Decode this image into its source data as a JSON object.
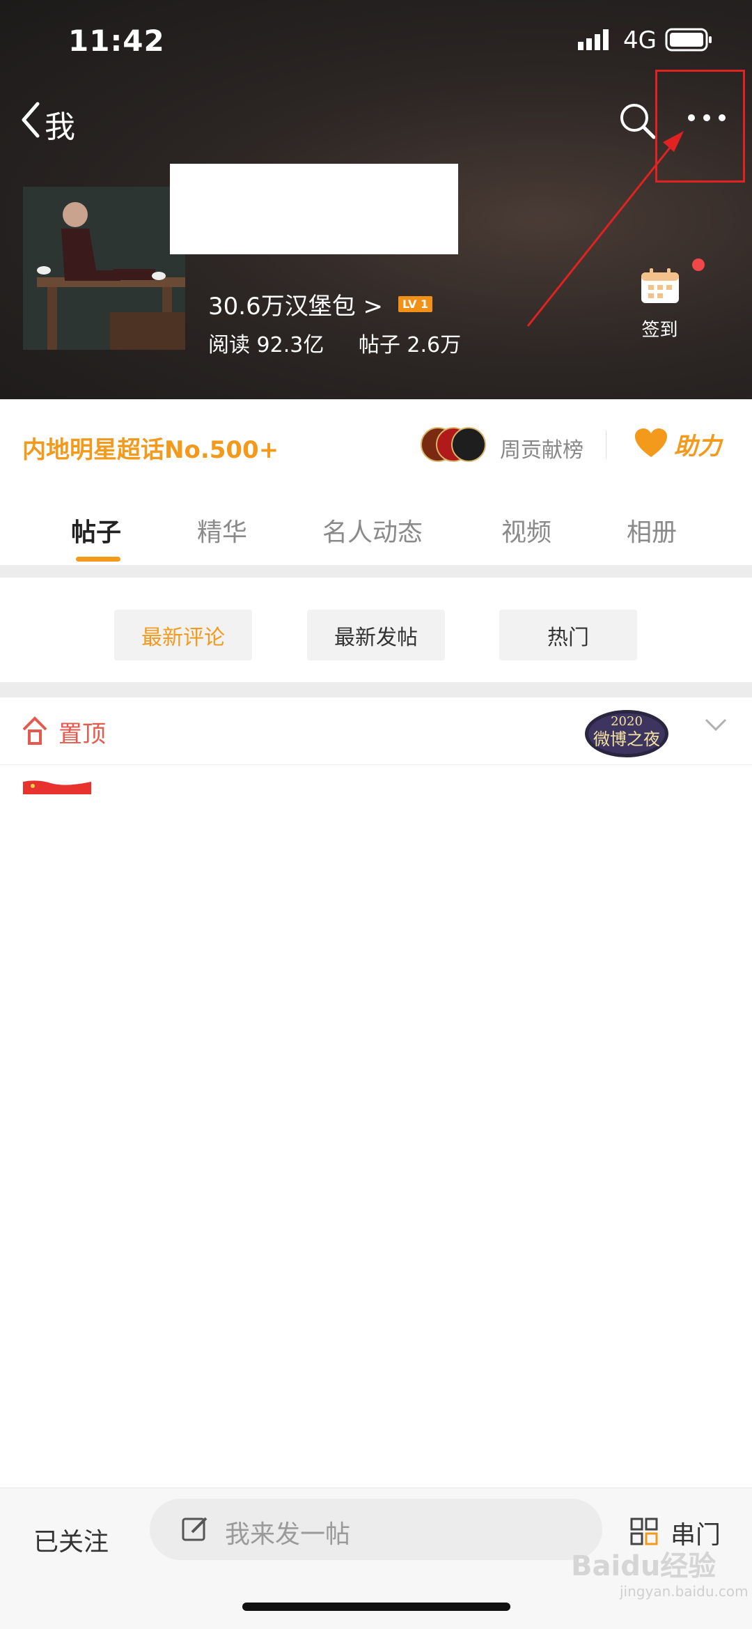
{
  "status_bar": {
    "time": "11:42",
    "network": "4G"
  },
  "nav": {
    "back_label": "我"
  },
  "header": {
    "stats_followers": "30.6万汉堡包 >",
    "level_badge": "LV 1",
    "reads": "阅读 92.3亿",
    "posts": "帖子 2.6万",
    "checkin_label": "签到"
  },
  "rank": {
    "title": "内地明星超话No.500+",
    "weekly_label": "周贡献榜",
    "boost_label": "助力"
  },
  "tabs": [
    {
      "label": "帖子",
      "active": true
    },
    {
      "label": "精华"
    },
    {
      "label": "名人动态"
    },
    {
      "label": "视频"
    },
    {
      "label": "相册"
    }
  ],
  "sort": [
    {
      "label": "最新评论",
      "active": true
    },
    {
      "label": "最新发帖"
    },
    {
      "label": "热门"
    }
  ],
  "pinned": {
    "label": "置顶",
    "badge_text": "2020 微博之夜"
  },
  "bottom": {
    "followed_label": "已关注",
    "post_placeholder": "我来发一帖",
    "stroll_label": "串门"
  },
  "watermark": {
    "text": "Baidu经验",
    "sub": "jingyan.baidu.com"
  },
  "colors": {
    "accent": "#f39a1d",
    "highlight": "#e02222",
    "pin": "#e55a4e"
  }
}
